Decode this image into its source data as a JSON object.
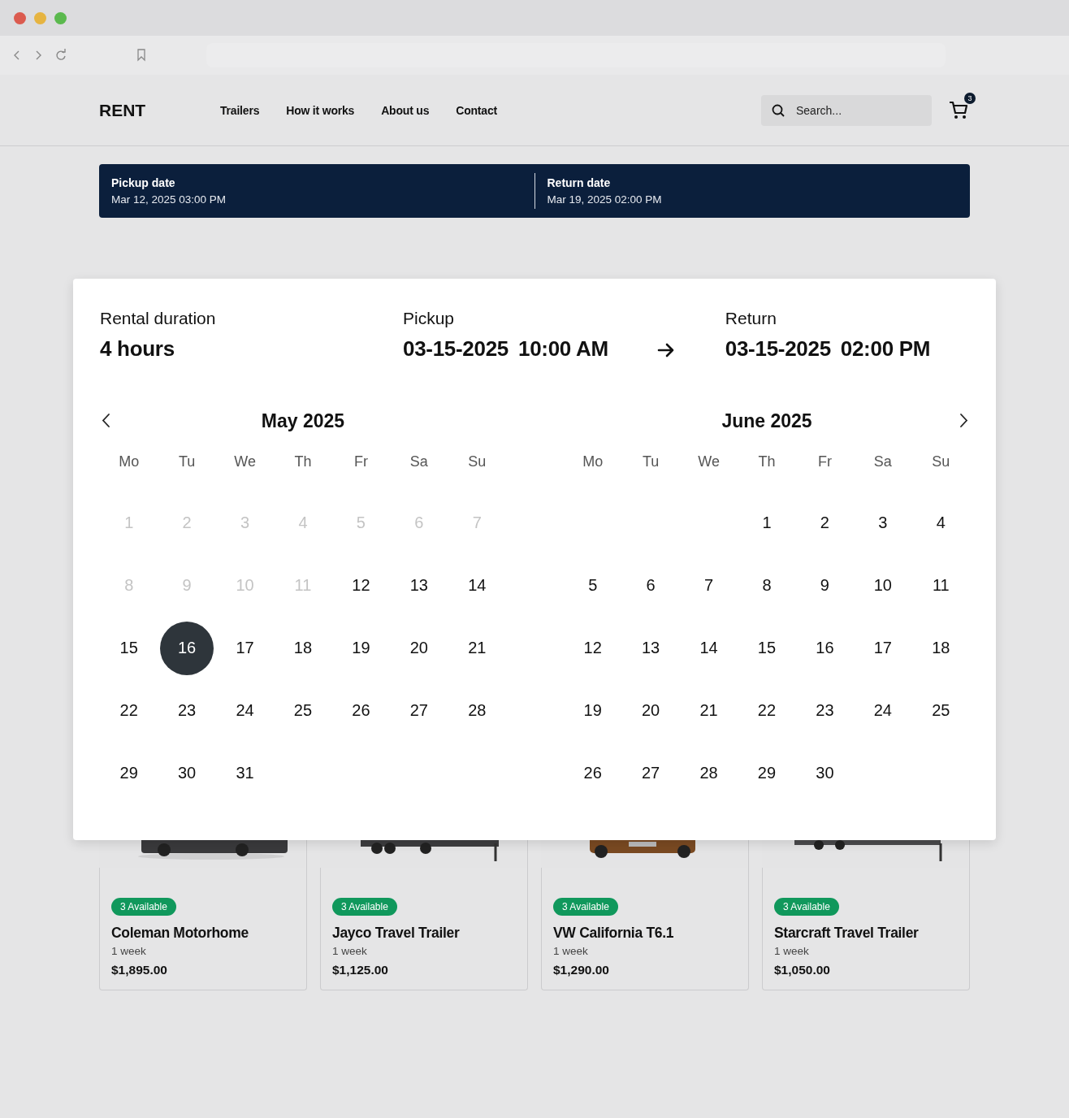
{
  "header": {
    "logo": "RENT",
    "nav": [
      {
        "label": "Trailers"
      },
      {
        "label": "How it works"
      },
      {
        "label": "About us"
      },
      {
        "label": "Contact"
      }
    ],
    "search": {
      "placeholder": "Search..."
    },
    "cart": {
      "count": "3"
    }
  },
  "date_bar": [
    {
      "label": "Pickup date",
      "value": "Mar 12, 2025 03:00 PM"
    },
    {
      "label": "Return date",
      "value": "Mar 19, 2025 02:00 PM"
    }
  ],
  "date_picker": {
    "duration": {
      "label": "Rental duration",
      "value": "4 hours"
    },
    "pickup": {
      "label": "Pickup",
      "date": "03-15-2025",
      "time": "10:00 AM"
    },
    "return": {
      "label": "Return",
      "date": "03-15-2025",
      "time": "02:00 PM"
    },
    "months": [
      {
        "title": "May 2025",
        "weekdays": [
          "Mo",
          "Tu",
          "We",
          "Th",
          "Fr",
          "Sa",
          "Su"
        ],
        "weeks": [
          [
            {
              "day": "1",
              "disabled": true,
              "selected": false
            },
            {
              "day": "2",
              "disabled": true,
              "selected": false
            },
            {
              "day": "3",
              "disabled": true,
              "selected": false
            },
            {
              "day": "4",
              "disabled": true,
              "selected": false
            },
            {
              "day": "5",
              "disabled": true,
              "selected": false
            },
            {
              "day": "6",
              "disabled": true,
              "selected": false
            },
            {
              "day": "7",
              "disabled": true,
              "selected": false
            }
          ],
          [
            {
              "day": "8",
              "disabled": true,
              "selected": false
            },
            {
              "day": "9",
              "disabled": true,
              "selected": false
            },
            {
              "day": "10",
              "disabled": true,
              "selected": false
            },
            {
              "day": "11",
              "disabled": true,
              "selected": false
            },
            {
              "day": "12",
              "disabled": false,
              "selected": false
            },
            {
              "day": "13",
              "disabled": false,
              "selected": false
            },
            {
              "day": "14",
              "disabled": false,
              "selected": false
            }
          ],
          [
            {
              "day": "15",
              "disabled": false,
              "selected": false
            },
            {
              "day": "16",
              "disabled": false,
              "selected": true
            },
            {
              "day": "17",
              "disabled": false,
              "selected": false
            },
            {
              "day": "18",
              "disabled": false,
              "selected": false
            },
            {
              "day": "19",
              "disabled": false,
              "selected": false
            },
            {
              "day": "20",
              "disabled": false,
              "selected": false
            },
            {
              "day": "21",
              "disabled": false,
              "selected": false
            }
          ],
          [
            {
              "day": "22",
              "disabled": false,
              "selected": false
            },
            {
              "day": "23",
              "disabled": false,
              "selected": false
            },
            {
              "day": "24",
              "disabled": false,
              "selected": false
            },
            {
              "day": "25",
              "disabled": false,
              "selected": false
            },
            {
              "day": "26",
              "disabled": false,
              "selected": false
            },
            {
              "day": "27",
              "disabled": false,
              "selected": false
            },
            {
              "day": "28",
              "disabled": false,
              "selected": false
            }
          ],
          {
            "leading_blanks": false,
            "days": [
              {
                "day": "29",
                "disabled": false,
                "selected": false
              },
              {
                "day": "30",
                "disabled": false,
                "selected": false
              },
              {
                "day": "31",
                "disabled": false,
                "selected": false
              }
            ]
          }
        ]
      },
      {
        "title": "June 2025",
        "weekdays": [
          "Mo",
          "Tu",
          "We",
          "Th",
          "Fr",
          "Sa",
          "Su"
        ],
        "weeks": [
          {
            "leading_blanks": true,
            "days": [
              {
                "day": "1",
                "disabled": false,
                "selected": false
              },
              {
                "day": "2",
                "disabled": false,
                "selected": false
              },
              {
                "day": "3",
                "disabled": false,
                "selected": false
              },
              {
                "day": "4",
                "disabled": false,
                "selected": false
              }
            ]
          },
          [
            {
              "day": "5",
              "disabled": false,
              "selected": false
            },
            {
              "day": "6",
              "disabled": false,
              "selected": false
            },
            {
              "day": "7",
              "disabled": false,
              "selected": false
            },
            {
              "day": "8",
              "disabled": false,
              "selected": false
            },
            {
              "day": "9",
              "disabled": false,
              "selected": false
            },
            {
              "day": "10",
              "disabled": false,
              "selected": false
            },
            {
              "day": "11",
              "disabled": false,
              "selected": false
            }
          ],
          [
            {
              "day": "12",
              "disabled": false,
              "selected": false
            },
            {
              "day": "13",
              "disabled": false,
              "selected": false
            },
            {
              "day": "14",
              "disabled": false,
              "selected": false
            },
            {
              "day": "15",
              "disabled": false,
              "selected": false
            },
            {
              "day": "16",
              "disabled": false,
              "selected": false
            },
            {
              "day": "17",
              "disabled": false,
              "selected": false
            },
            {
              "day": "18",
              "disabled": false,
              "selected": false
            }
          ],
          [
            {
              "day": "19",
              "disabled": false,
              "selected": false
            },
            {
              "day": "20",
              "disabled": false,
              "selected": false
            },
            {
              "day": "21",
              "disabled": false,
              "selected": false
            },
            {
              "day": "22",
              "disabled": false,
              "selected": false
            },
            {
              "day": "23",
              "disabled": false,
              "selected": false
            },
            {
              "day": "24",
              "disabled": false,
              "selected": false
            },
            {
              "day": "25",
              "disabled": false,
              "selected": false
            }
          ],
          {
            "leading_blanks": false,
            "days": [
              {
                "day": "26",
                "disabled": false,
                "selected": false
              },
              {
                "day": "27",
                "disabled": false,
                "selected": false
              },
              {
                "day": "28",
                "disabled": false,
                "selected": false
              },
              {
                "day": "29",
                "disabled": false,
                "selected": false
              },
              {
                "day": "30",
                "disabled": false,
                "selected": false
              }
            ]
          }
        ]
      }
    ]
  },
  "products": [
    {
      "badge": "3 Available",
      "name": "Coleman Motorhome",
      "period": "1 week",
      "price": "$1,895.00"
    },
    {
      "badge": "3 Available",
      "name": "Jayco Travel Trailer",
      "period": "1 week",
      "price": "$1,125.00"
    },
    {
      "badge": "3 Available",
      "name": "VW California T6.1",
      "period": "1 week",
      "price": "$1,290.00"
    },
    {
      "badge": "3 Available",
      "name": "Starcraft Travel Trailer",
      "period": "1 week",
      "price": "$1,050.00"
    }
  ]
}
